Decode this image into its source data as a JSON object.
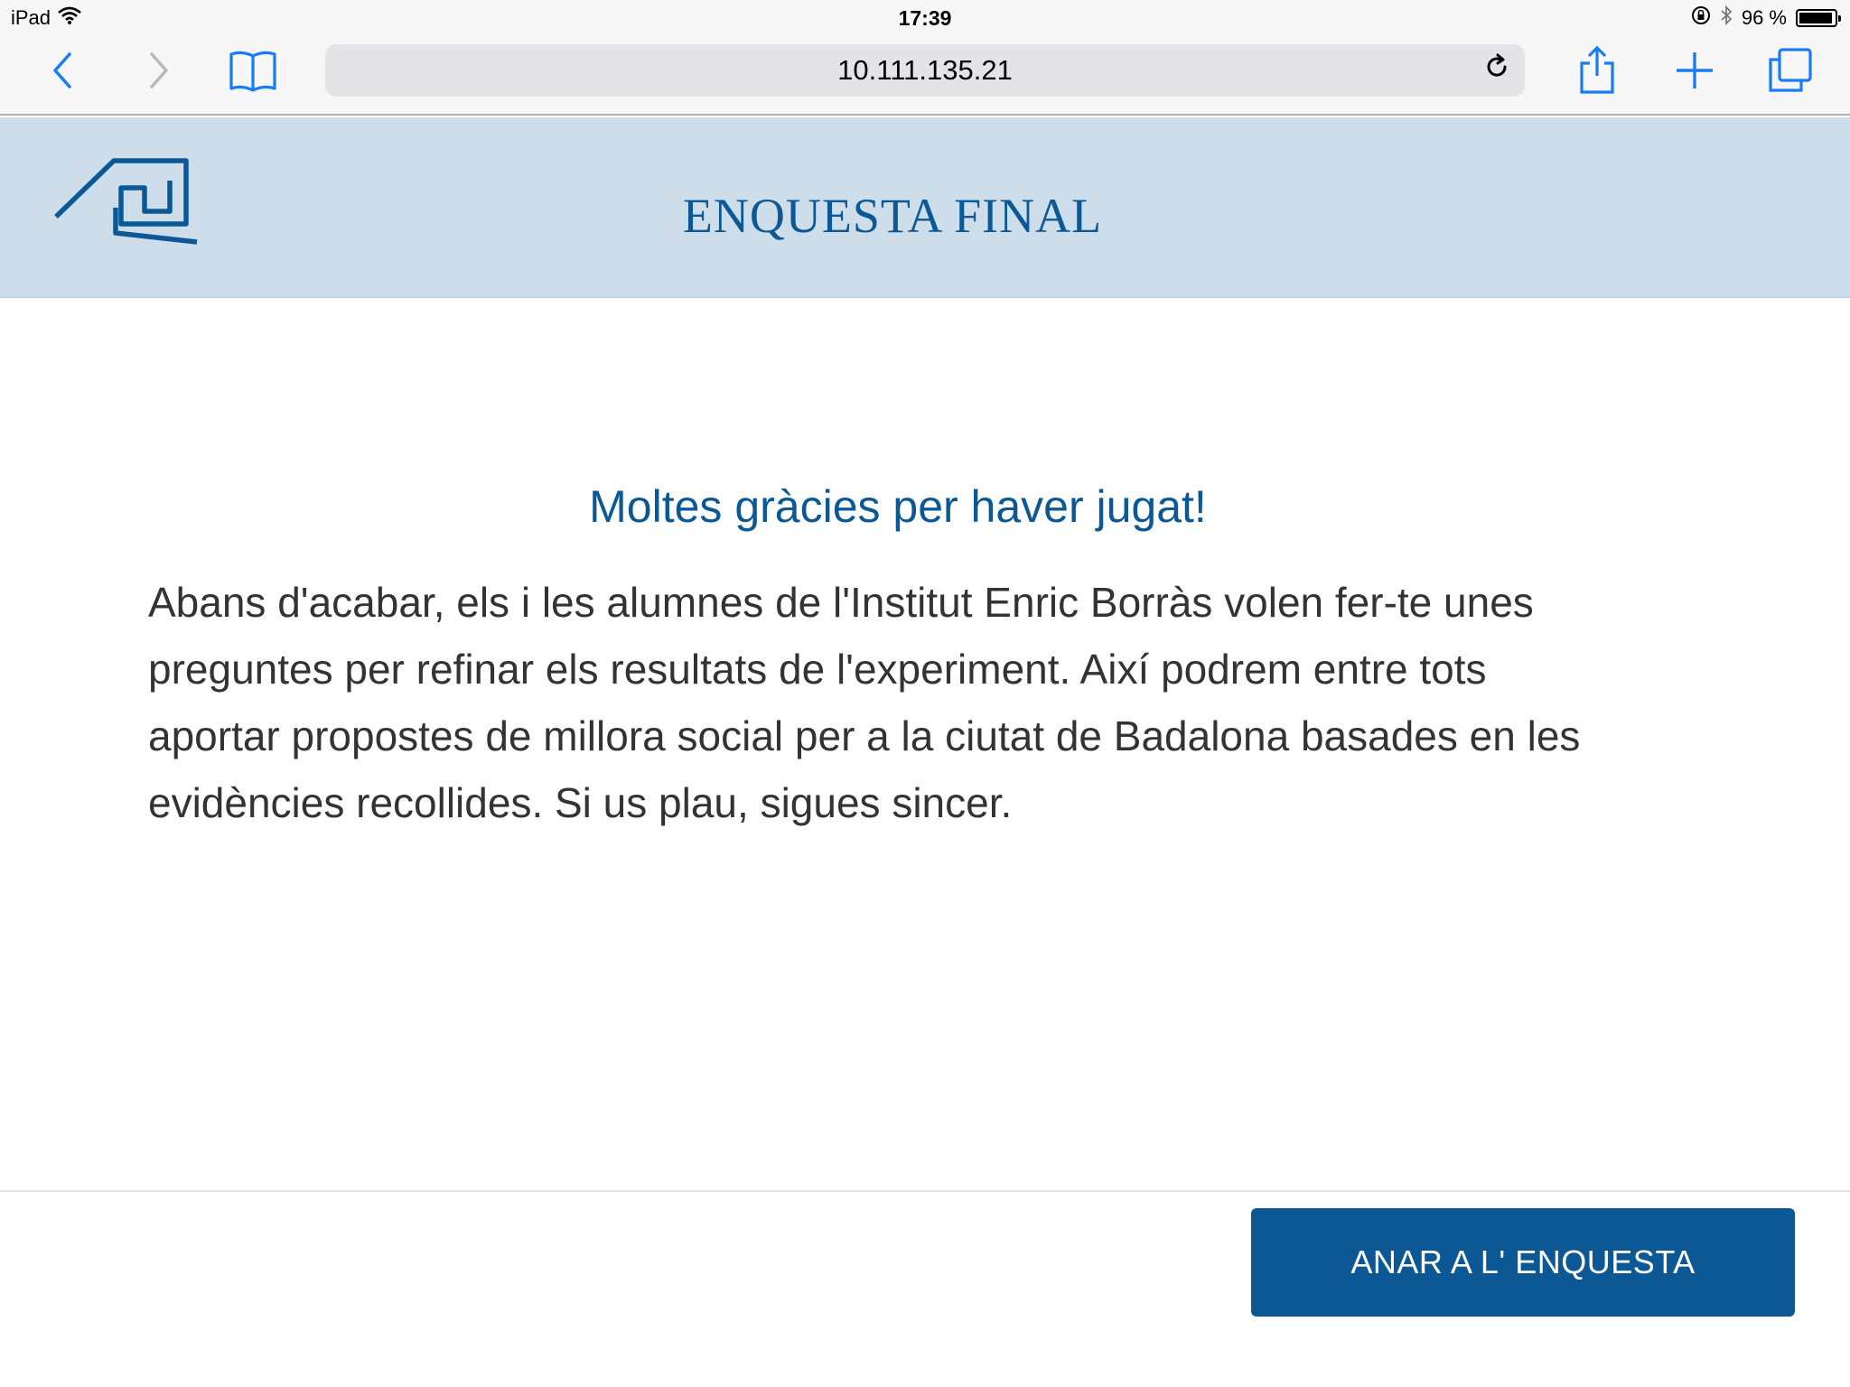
{
  "status_bar": {
    "device": "iPad",
    "time": "17:39",
    "battery": "96 %",
    "battery_level": 0.96,
    "icons": [
      "wifi-icon",
      "rotation-lock-icon",
      "bluetooth-icon",
      "battery-icon"
    ]
  },
  "browser": {
    "url": "10.111.135.21",
    "icons": [
      "back-icon",
      "forward-icon",
      "bookmarks-icon",
      "reload-icon",
      "share-icon",
      "new-tab-icon",
      "tabs-icon"
    ]
  },
  "app": {
    "title": "ENQUESTA FINAL",
    "logo": "app-logo",
    "brand_color": "#0b5895",
    "header_bg": "#cddde9"
  },
  "main": {
    "heading": "Moltes gràcies per haver jugat!",
    "body": "Abans d'acabar, els i les alumnes de l'Institut Enric Borràs volen fer-te unes preguntes per refinar els resultats de l'experiment. Així podrem entre tots aportar propostes de millora social per a la ciutat de Badalona basades en les evidències recollides. Si us plau, sigues sincer."
  },
  "footer": {
    "cta_label": "ANAR A L' ENQUESTA"
  }
}
